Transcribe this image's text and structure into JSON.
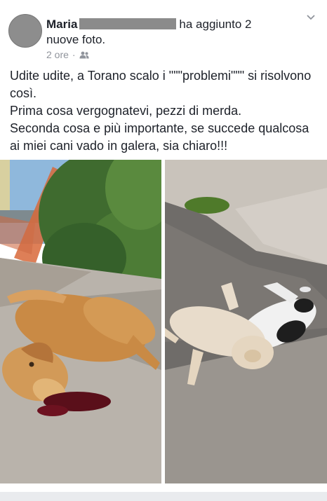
{
  "post": {
    "author": "Maria",
    "action_text": "ha aggiunto 2",
    "action_text_line2": "nuove foto.",
    "time": "2 ore",
    "separator": "·",
    "privacy_icon": "friends-icon",
    "body": [
      "Udite udite, a Torano scalo i \"\"\"problemi\"\"\" si risolvono così.",
      "Prima cosa vergognatevi, pezzi di merda.",
      "Seconda cosa e più importante, se succede qualcosa ai miei cani vado in galera, sia chiaro!!!"
    ]
  },
  "colors": {
    "background": "#e9ebee",
    "card": "#ffffff",
    "meta_text": "#90949c",
    "body_text": "#1d2129"
  }
}
